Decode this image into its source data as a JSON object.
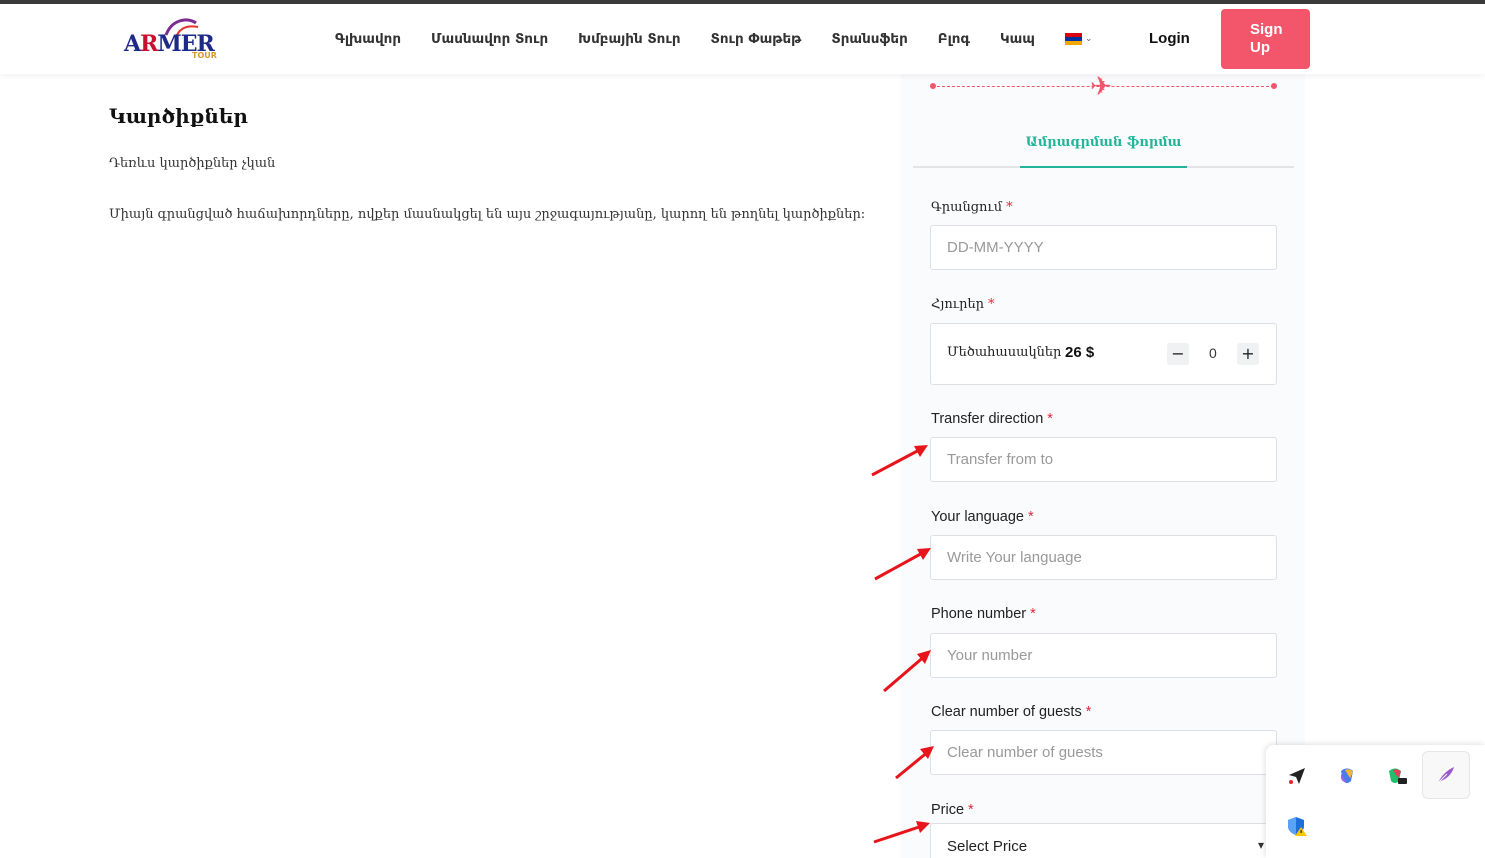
{
  "brand": {
    "logo_text_a": "A",
    "logo_text_r": "R",
    "logo_text_rest": "MER",
    "logo_sub": "TOUR"
  },
  "nav": {
    "items": [
      "Գլխավոր",
      "Մասնավոր Տուր",
      "Խմբային Տուր",
      "Տուր Փաթեթ",
      "Տրանսֆեր",
      "Բլոգ",
      "Կապ"
    ],
    "language_flag_colors": [
      "#d90012",
      "#0033a0",
      "#f2a800"
    ],
    "login_label": "Login",
    "signup_label": "Sign Up"
  },
  "reviews": {
    "title": "Կարծիքներ",
    "empty_text": "Դեռևս կարծիքներ չկան",
    "note": "Միայն գրանցված հաճախորդները, ովքեր մասնակցել են այս շրջագայությանը, կարող են թողնել կարծիքներ:"
  },
  "booking": {
    "tab_label": "Ամրագրման ֆորմա",
    "date_label": "Գրանցում",
    "date_placeholder": "DD-MM-YYYY",
    "guests_label": "Հյուրեր",
    "adults_label": "Մեծահասակներ",
    "adults_price": "26 $",
    "adults_count": "0",
    "minus": "−",
    "plus": "+",
    "transfer_label": "Transfer direction",
    "transfer_placeholder": "Transfer from to",
    "language_label": "Your language",
    "language_placeholder": "Write Your language",
    "phone_label": "Phone number",
    "phone_placeholder": "Your number",
    "clear_guests_label": "Clear number of guests",
    "clear_guests_placeholder": "Clear number of guests",
    "price_label": "Price",
    "price_selected": "Select Price",
    "required_mark": "*"
  },
  "colors": {
    "accent": "#f3556a",
    "tab": "#22b59a",
    "required": "#e0283c",
    "annotation_arrow": "#e8141c"
  },
  "extensions": [
    "send-icon",
    "copilot-icon",
    "copilot-pro-icon",
    "feather-icon",
    "shield-warning-icon"
  ]
}
